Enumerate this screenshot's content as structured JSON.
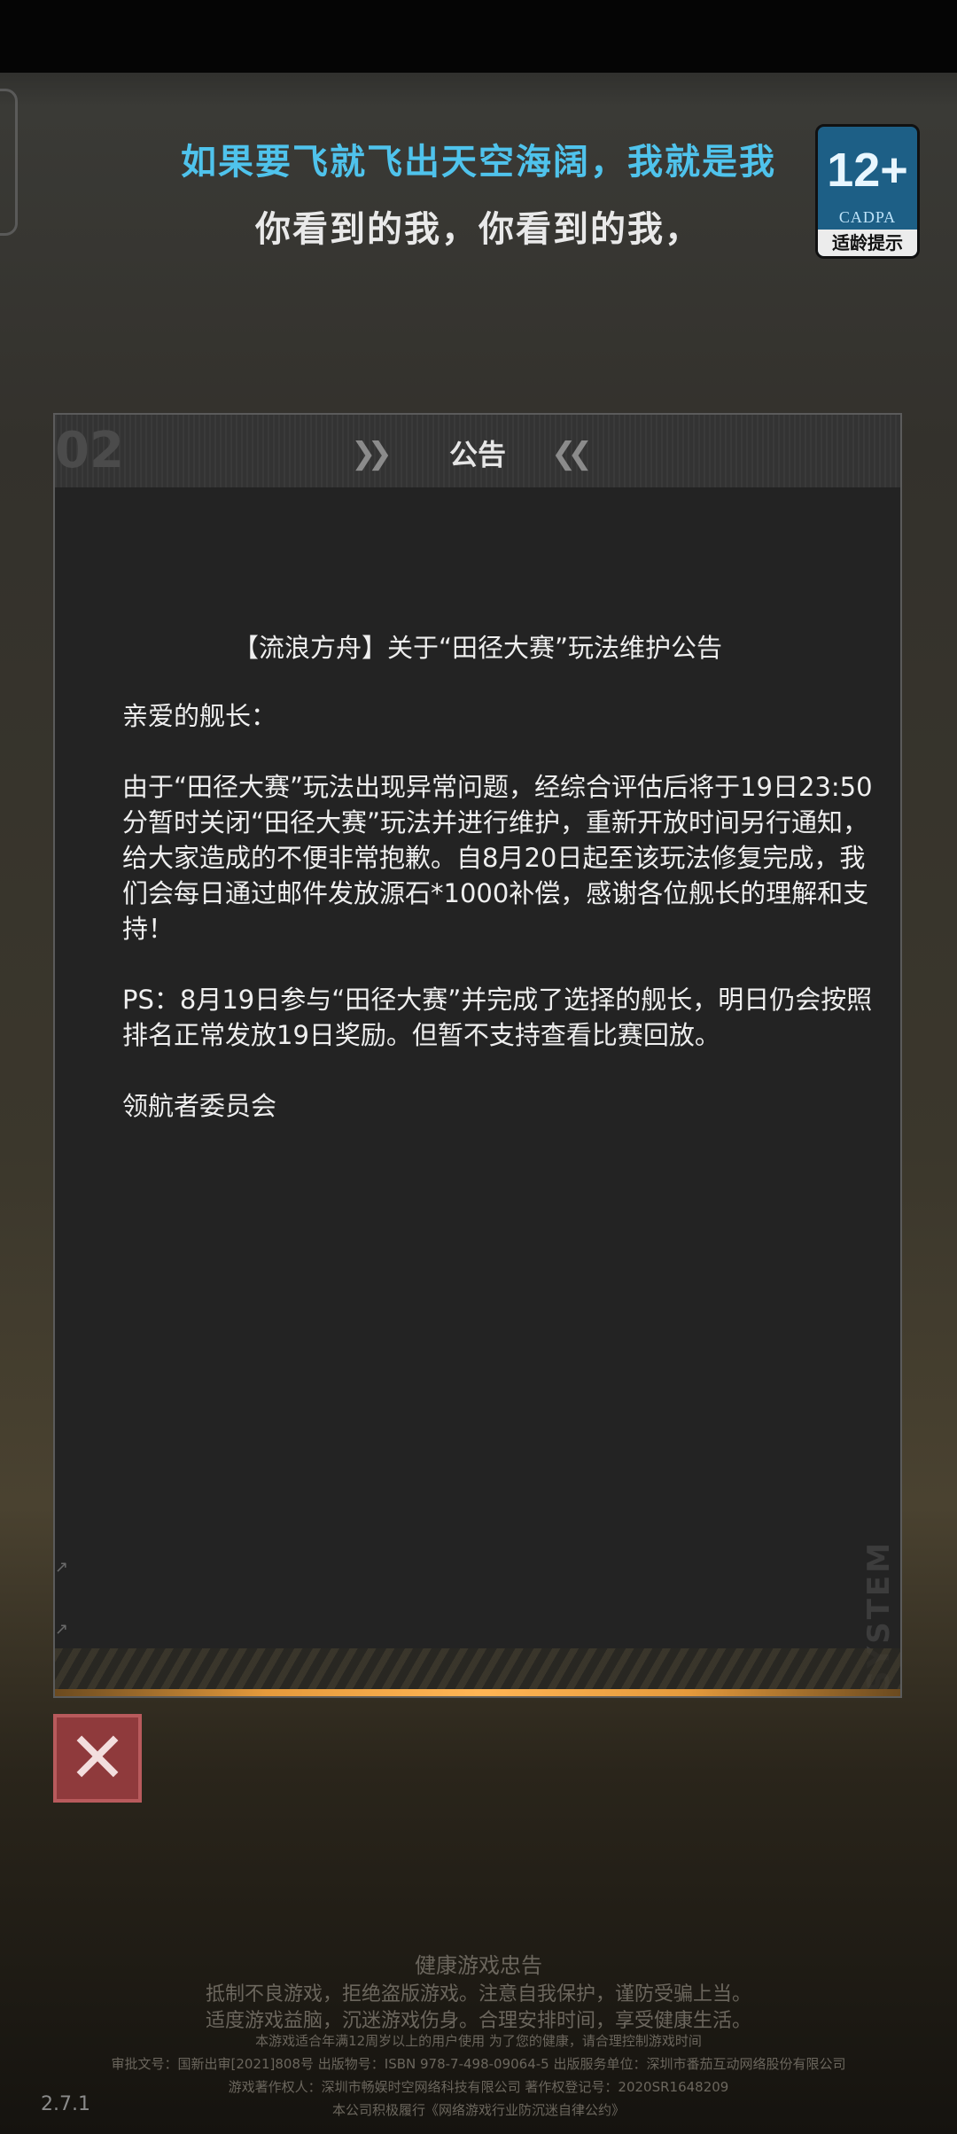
{
  "lyrics": {
    "line1": "如果要飞就飞出天空海阔，我就是我",
    "line2": "你看到的我，你看到的我，"
  },
  "age_badge": {
    "rating": "12+",
    "org": "CADPA",
    "label": "适龄提示"
  },
  "panel": {
    "header_number": "02",
    "title": "公告",
    "chevron_left": "❯❯",
    "chevron_right": "❮❮",
    "side_text": "SYSTEM"
  },
  "notice": {
    "heading": "【流浪方舟】关于“田径大赛”玩法维护公告",
    "greeting": "亲爱的舰长：",
    "paragraph1": "由于“田径大赛”玩法出现异常问题，经综合评估后将于19日23:50分暂时关闭“田径大赛”玩法并进行维护，重新开放时间另行通知，给大家造成的不便非常抱歉。自8月20日起至该玩法修复完成，我们会每日通过邮件发放源石*1000补偿，感谢各位舰长的理解和支持！",
    "paragraph2": "PS：8月19日参与“田径大赛”并完成了选择的舰长，明日仍会按照排名正常发放19日奖励。但暂不支持查看比赛回放。",
    "signature": "领航者委员会"
  },
  "close_button": {
    "icon": "close-icon",
    "glyph": "✕"
  },
  "health_advice": {
    "title": "健康游戏忠告",
    "line1": "抵制不良游戏，拒绝盗版游戏。注意自我保护，谨防受骗上当。",
    "line2": "适度游戏益脑，沉迷游戏伤身。合理安排时间，享受健康生活。",
    "small1": "本游戏适合年满12周岁以上的用户使用 为了您的健康，请合理控制游戏时间",
    "small2": "审批文号：国新出审[2021]808号 出版物号：ISBN 978-7-498-09064-5 出版服务单位：深圳市番茄互动网络股份有限公司",
    "small3": "游戏著作权人：深圳市畅娱时空网络科技有限公司 著作权登记号：2020SR1648209",
    "small4": "本公司积极履行《网络游戏行业防沉迷自律公约》"
  },
  "version": "2.7.1",
  "colors": {
    "lyric_accent": "#4fc3ec",
    "close_red": "#8f3a3c",
    "glow": "#e59a3c"
  }
}
